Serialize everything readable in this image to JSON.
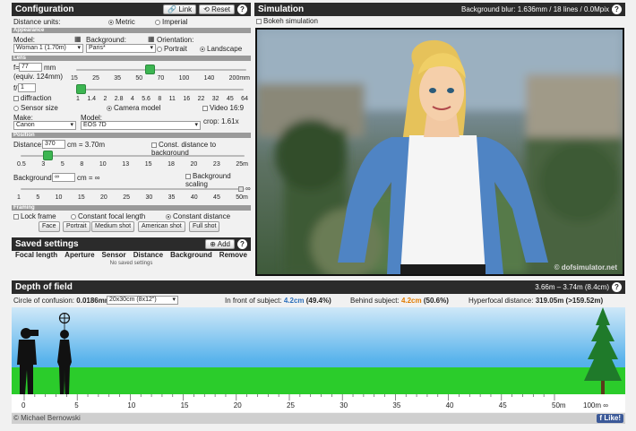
{
  "config": {
    "title": "Configuration",
    "link_label": "Link",
    "reset_label": "Reset",
    "help": "?",
    "units_label": "Distance units:",
    "units_metric": "Metric",
    "units_imperial": "Imperial",
    "appearance": {
      "section": "Appearance",
      "model_label": "Model:",
      "model_value": "Woman 1 (1.70m)",
      "background_label": "Background:",
      "background_value": "Paris*",
      "orientation_label": "Orientation:",
      "portrait": "Portrait",
      "landscape": "Landscape"
    },
    "lens": {
      "section": "Lens",
      "f_label": "f=",
      "f_value": "77",
      "f_unit": "mm",
      "equiv": "(equiv. 124mm)",
      "focal_ticks": [
        "15",
        "25",
        "35",
        "50",
        "70",
        "100",
        "140",
        "200mm"
      ],
      "focal_position": 0.43,
      "aperture_label": "f/",
      "aperture_value": "1",
      "aperture_ticks": [
        "1",
        "1.4",
        "2",
        "2.8",
        "4",
        "5.6",
        "8",
        "11",
        "16",
        "22",
        "32",
        "45",
        "64"
      ],
      "aperture_position": 0.0,
      "diffraction": "diffraction",
      "sensor_size": "Sensor size",
      "camera_model": "Camera model",
      "video": "Video 16:9",
      "make_label": "Make:",
      "make_value": "Canon",
      "cam_model_label": "Model:",
      "cam_model_value": "EOS 7D",
      "crop": "crop: 1.61x"
    },
    "position": {
      "section": "Position",
      "distance_label": "Distance:",
      "distance_value": "370",
      "distance_suffix": "cm = 3.70m",
      "const_distance_bg": "Const. distance to background",
      "distance_ticks": [
        "0.5",
        "3",
        "5",
        "8",
        "10",
        "13",
        "15",
        "18",
        "20",
        "23",
        "25m"
      ],
      "distance_position": 0.12,
      "background_label": "Background:",
      "background_value": "∞",
      "background_suffix": "cm = ∞",
      "bg_scaling": "Background scaling",
      "bg_ticks": [
        "1",
        "5",
        "10",
        "15",
        "20",
        "25",
        "30",
        "35",
        "40",
        "45",
        "50m"
      ],
      "inf_label": "∞"
    },
    "framing": {
      "section": "Framing",
      "lock_frame": "Lock frame",
      "const_focal": "Constant focal length",
      "const_distance": "Constant distance",
      "buttons": [
        "Face",
        "Portrait",
        "Medium shot",
        "American shot",
        "Full shot"
      ]
    }
  },
  "saved": {
    "title": "Saved settings",
    "add_label": "Add",
    "help": "?",
    "columns": [
      "Focal length",
      "Aperture",
      "Sensor",
      "Distance",
      "Background",
      "Remove"
    ],
    "empty": "No saved settings"
  },
  "simulation": {
    "title": "Simulation",
    "blur_info": "Background blur: 1.636mm / 18 lines / 0.0Mpix",
    "help": "?",
    "bokeh": "Bokeh simulation",
    "watermark": "© dofsimulator.net"
  },
  "dof": {
    "title": "Depth of field",
    "range": "3.66m – 3.74m (8.4cm)",
    "help": "?",
    "coc_label": "Circle of confusion:",
    "coc_value": "0.0186mm",
    "print_value": "20x30cm (8x12\")",
    "front_label": "In front of subject:",
    "front_value": "4.2cm",
    "front_pct": "(49.4%)",
    "behind_label": "Behind subject:",
    "behind_value": "4.2cm",
    "behind_pct": "(50.6%)",
    "hyper_label": "Hyperfocal distance:",
    "hyper_value": "319.05m",
    "hyper_ft": "(>159.52m)",
    "ruler_ticks": [
      "0",
      "5",
      "10",
      "15",
      "20",
      "25",
      "30",
      "35",
      "40",
      "45",
      "50m"
    ],
    "ruler_end": "100m",
    "ruler_inf": "∞"
  },
  "footer": {
    "author": "© Michael Bernowski",
    "like": "Like!"
  },
  "colors": {
    "accent": "#3cb551",
    "dark": "#2b2b2b",
    "orange": "#e07b00",
    "blue": "#2a6ebb"
  }
}
